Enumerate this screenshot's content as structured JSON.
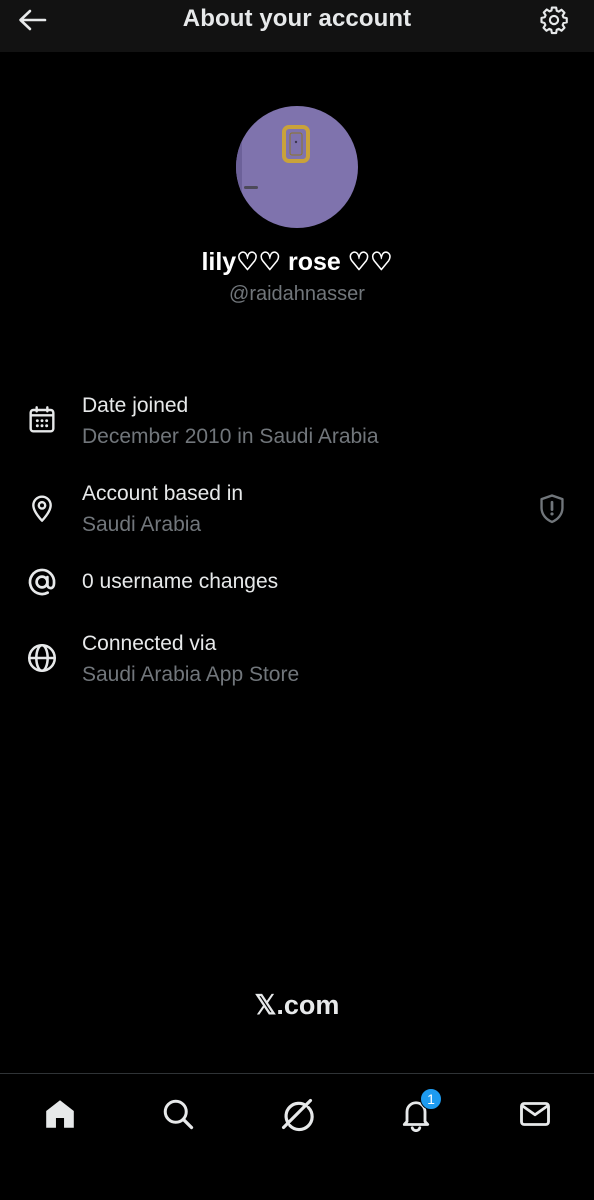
{
  "header": {
    "title": "About your account",
    "back_icon": "arrow-left-icon",
    "settings_icon": "gear-icon"
  },
  "profile": {
    "display_name": "lily♡♡ rose ♡♡",
    "handle": "@raidahnasser"
  },
  "info": [
    {
      "icon": "calendar-icon",
      "label": "Date joined",
      "value": "December 2010 in Saudi Arabia"
    },
    {
      "icon": "location-pin-icon",
      "label": "Account based in",
      "value": "Saudi Arabia"
    },
    {
      "icon": "at-sign-icon",
      "label": "0 username changes"
    },
    {
      "icon": "globe-icon",
      "label": "Connected via",
      "value": "Saudi Arabia App Store"
    }
  ],
  "footer": {
    "brand": "𝕏.com"
  },
  "tabbar": {
    "items": [
      "home-icon",
      "search-icon",
      "grok-icon",
      "bell-icon",
      "mail-icon"
    ],
    "notification_count": "1"
  },
  "colors": {
    "background": "#000000",
    "primary_text": "#e7e9ea",
    "secondary_text": "#71767b",
    "accent": "#1d9bf0",
    "avatar": "#7f73ad"
  }
}
